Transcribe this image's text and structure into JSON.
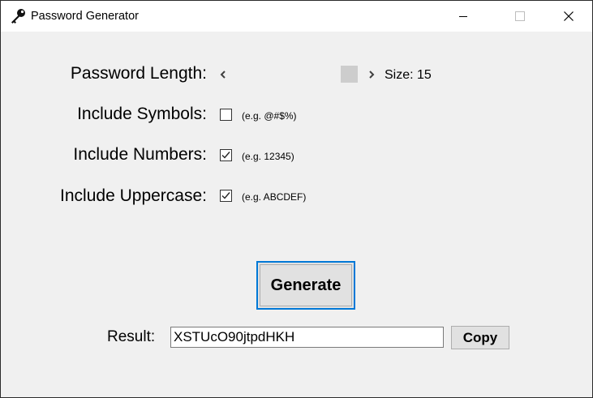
{
  "window": {
    "title": "Password Generator",
    "icon": "key-icon"
  },
  "form": {
    "length": {
      "label": "Password Length:",
      "size_text": "Size: 15",
      "value": 15
    },
    "symbols": {
      "label": "Include Symbols:",
      "checked": false,
      "hint": "(e.g. @#$%)"
    },
    "numbers": {
      "label": "Include Numbers:",
      "checked": true,
      "hint": "(e.g. 12345)"
    },
    "uppercase": {
      "label": "Include Uppercase:",
      "checked": true,
      "hint": "(e.g. ABCDEF)"
    }
  },
  "actions": {
    "generate_label": "Generate",
    "copy_label": "Copy"
  },
  "result": {
    "label": "Result:",
    "value": "XSTUcO90jtpdHKH"
  },
  "colors": {
    "focus_border": "#0078d7",
    "button_face": "#e1e1e1",
    "window_bg": "#f0f0f0"
  }
}
